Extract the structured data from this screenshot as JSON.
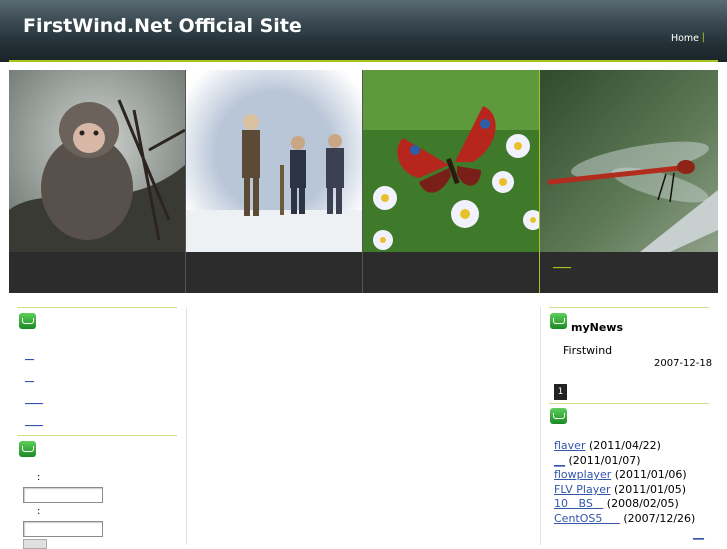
{
  "header": {
    "title": "FirstWind.Net Official Site",
    "nav": [
      {
        "label": "Home"
      }
    ],
    "separator": "|"
  },
  "banner": {
    "images": [
      {
        "name": "monkey-photo"
      },
      {
        "name": "hikers-snow-photo"
      },
      {
        "name": "butterfly-photo"
      },
      {
        "name": "dragonfly-photo"
      }
    ],
    "caption_link": "____"
  },
  "left": {
    "menu_links": [
      "__",
      "__",
      "____",
      "____"
    ],
    "login": {
      "user_label": ":",
      "password_label": ":"
    }
  },
  "mynews": {
    "title": "myNews",
    "author": "Firstwind",
    "date": "2007-12-18",
    "page": "1"
  },
  "recent": {
    "items": [
      {
        "link": "flaver",
        "date": " (2011/04/22)"
      },
      {
        "link": "__",
        "date": " (2011/01/07)"
      },
      {
        "link": "flowplayer",
        "date": " (2011/01/06)"
      },
      {
        "link": "FLV Player",
        "date": " (2011/01/05)"
      },
      {
        "link": "10   BS   ",
        "date": " (2008/02/05)"
      },
      {
        "link": "CentOS5     ",
        "date": " (2007/12/26)"
      }
    ],
    "more": "__"
  },
  "colors": {
    "accent": "#a8c41e",
    "link": "#3355aa",
    "header_dark": "#233036"
  }
}
